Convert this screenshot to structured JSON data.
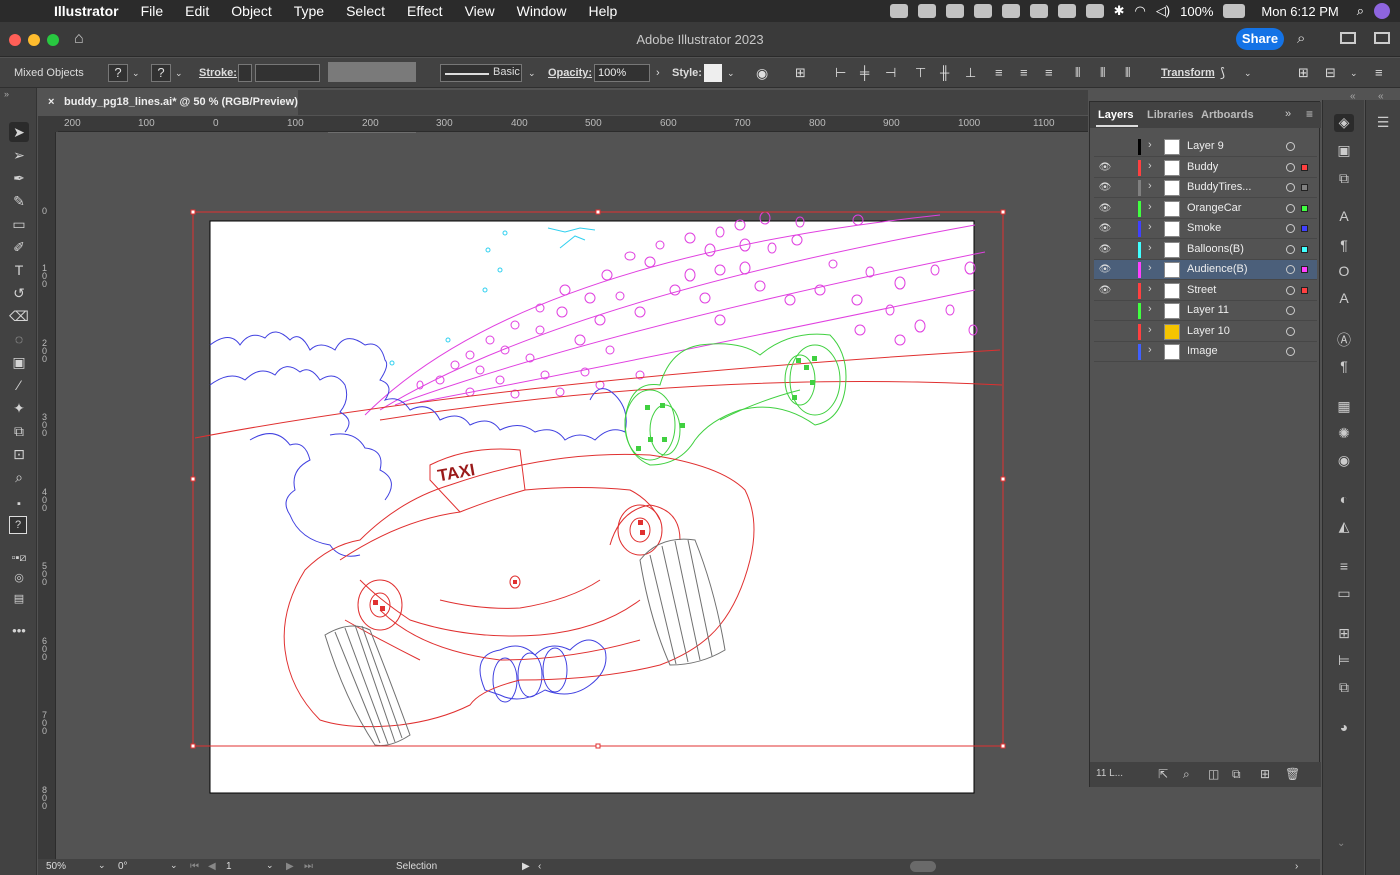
{
  "menubar": {
    "app_name": "Illustrator",
    "items": [
      "File",
      "Edit",
      "Object",
      "Type",
      "Select",
      "Effect",
      "View",
      "Window",
      "Help"
    ],
    "battery": "100%",
    "clock": "Mon 6:12 PM"
  },
  "titlebar": {
    "title": "Adobe Illustrator 2023",
    "share_label": "Share"
  },
  "controlbar": {
    "selection_type": "Mixed Objects",
    "fill_glyph": "?",
    "stroke_glyph": "?",
    "stroke_label": "Stroke:",
    "brush_label": "Basic",
    "opacity_label": "Opacity:",
    "opacity_value": "100%",
    "style_label": "Style:",
    "transform_label": "Transform"
  },
  "document_tab": {
    "close_glyph": "×",
    "title": "buddy_pg18_lines.ai* @ 50 % (RGB/Preview)"
  },
  "ruler": {
    "h_ticks": [
      "200",
      "100",
      "0",
      "100",
      "200",
      "300",
      "400",
      "500",
      "600",
      "700",
      "800",
      "900",
      "1000",
      "1100"
    ],
    "v_ticks": [
      "0",
      "100",
      "200",
      "300",
      "400",
      "500",
      "600",
      "700",
      "800"
    ]
  },
  "artwork": {
    "taxi_sign": "TAXI"
  },
  "layers_panel": {
    "tabs": [
      "Layers",
      "Libraries",
      "Artboards"
    ],
    "layers": [
      {
        "name": "Layer 9",
        "color": "#000000",
        "visible": false,
        "selected": false
      },
      {
        "name": "Buddy",
        "color": "#ff4040",
        "visible": true,
        "selected": false
      },
      {
        "name": "BuddyTires...",
        "color": "#808080",
        "visible": true,
        "selected": false
      },
      {
        "name": "OrangeCar",
        "color": "#40ff40",
        "visible": true,
        "selected": false
      },
      {
        "name": "Smoke",
        "color": "#4040ff",
        "visible": true,
        "selected": false
      },
      {
        "name": "Balloons(B)",
        "color": "#40ffff",
        "visible": true,
        "selected": false
      },
      {
        "name": "Audience(B)",
        "color": "#ff40ff",
        "visible": true,
        "selected": true
      },
      {
        "name": "Street",
        "color": "#ff4040",
        "visible": true,
        "selected": false
      },
      {
        "name": "Layer 11",
        "color": "#40ff40",
        "visible": false,
        "selected": false
      },
      {
        "name": "Layer 10",
        "color": "#ff4040",
        "visible": false,
        "selected": false
      },
      {
        "name": "Image",
        "color": "#4060ff",
        "visible": false,
        "selected": false
      }
    ],
    "footer_count": "11 L..."
  },
  "statusbar": {
    "zoom": "50%",
    "rotation": "0°",
    "artboard": "1",
    "tool": "Selection"
  }
}
